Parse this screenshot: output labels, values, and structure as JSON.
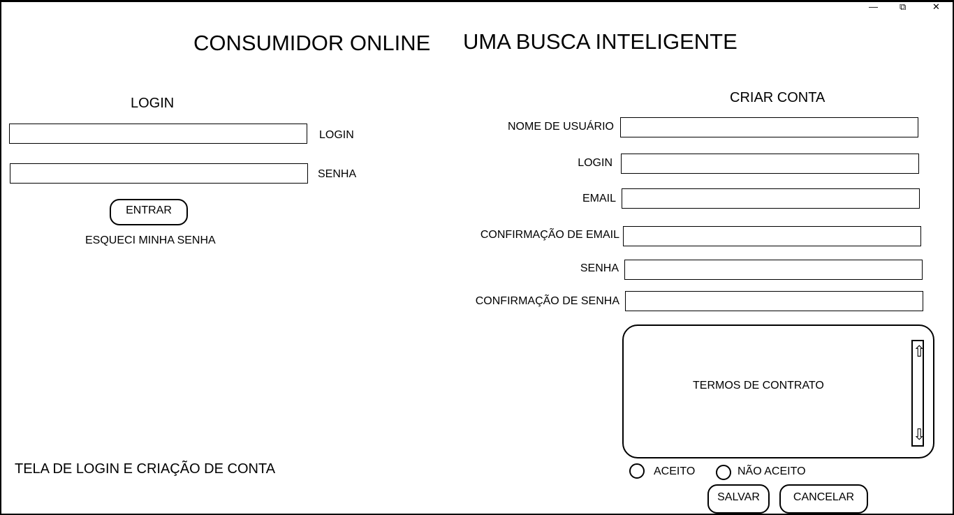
{
  "window_controls": {
    "minimize": "—",
    "restore": "⧉",
    "close": "✕"
  },
  "header": {
    "title_left": "CONSUMIDOR ONLINE",
    "title_right": "UMA BUSCA INTELIGENTE"
  },
  "login": {
    "heading": "LOGIN",
    "login_label": "LOGIN",
    "login_value": "",
    "password_label": "SENHA",
    "password_value": "",
    "enter_button": "ENTRAR",
    "forgot_link": "ESQUECI MINHA SENHA"
  },
  "create_account": {
    "heading": "CRIAR CONTA",
    "fields": [
      {
        "label": "NOME DE USUÁRIO",
        "value": ""
      },
      {
        "label": "LOGIN",
        "value": ""
      },
      {
        "label": "EMAIL",
        "value": ""
      },
      {
        "label": "CONFIRMAÇÃO DE EMAIL",
        "value": ""
      },
      {
        "label": "SENHA",
        "value": ""
      },
      {
        "label": "CONFIRMAÇÃO DE SENHA",
        "value": ""
      }
    ],
    "terms_text": "TERMOS DE CONTRATO",
    "scroll_up_icon": "up-arrow-icon",
    "scroll_down_icon": "down-arrow-icon",
    "accept_label": "ACEITO",
    "decline_label": "NÃO ACEITO",
    "save_button": "SALVAR",
    "cancel_button": "CANCELAR"
  },
  "footer_caption": "TELA DE LOGIN E CRIAÇÃO DE CONTA"
}
